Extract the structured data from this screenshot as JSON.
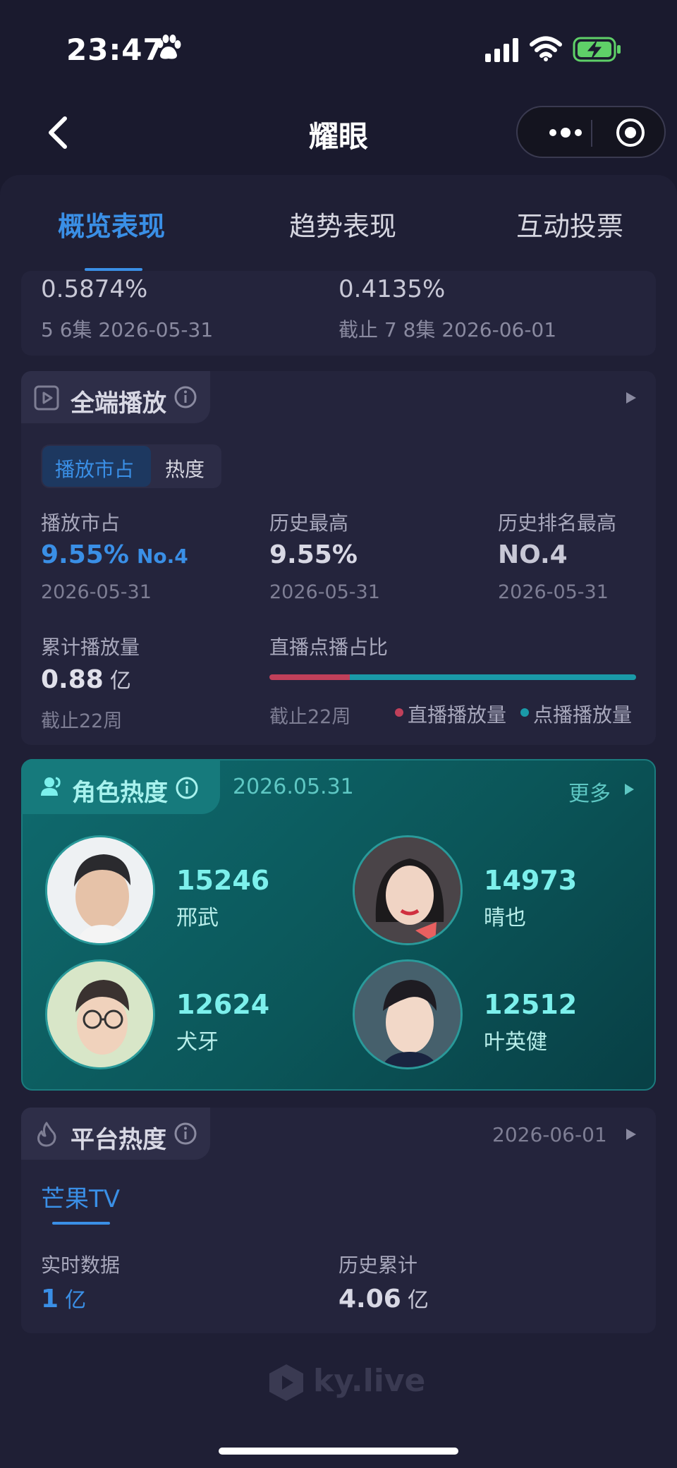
{
  "status_bar": {
    "time": "23:47"
  },
  "nav": {
    "title": "耀眼"
  },
  "tabs": [
    {
      "label": "概览表现",
      "active": true
    },
    {
      "label": "趋势表现",
      "active": false
    },
    {
      "label": "互动投票",
      "active": false
    }
  ],
  "top_stats": [
    {
      "value": "0.5874%",
      "sub": "5 6集 2026-05-31"
    },
    {
      "value": "0.4135%",
      "sub": "截止 7 8集 2026-06-01"
    }
  ],
  "playback": {
    "title": "全端播放",
    "toggle": [
      "播放市占",
      "热度"
    ],
    "market_share": {
      "label": "播放市占",
      "value": "9.55%",
      "rank": "No.4",
      "date": "2026-05-31"
    },
    "history_high": {
      "label": "历史最高",
      "value": "9.55%",
      "date": "2026-05-31"
    },
    "history_rank": {
      "label": "历史排名最高",
      "value": "NO.4",
      "date": "2026-05-31"
    },
    "cumulative": {
      "label": "累计播放量",
      "value": "0.88",
      "unit": "亿",
      "sub": "截止22周"
    },
    "ratio": {
      "label": "直播点播占比",
      "sub": "截止22周",
      "legend": [
        "直播播放量",
        "点播播放量"
      ],
      "live_fraction": 0.22,
      "colors": {
        "live": "#c0405a",
        "vod": "#1a9aa8"
      }
    }
  },
  "role_heat": {
    "title": "角色热度",
    "date": "2026.05.31",
    "more": "更多",
    "roles": [
      {
        "score": "15246",
        "name": "邢武"
      },
      {
        "score": "14973",
        "name": "晴也"
      },
      {
        "score": "12624",
        "name": "犬牙"
      },
      {
        "score": "12512",
        "name": "叶英健"
      }
    ]
  },
  "platform_heat": {
    "title": "平台热度",
    "date": "2026-06-01",
    "platform_tab": "芒果TV",
    "realtime": {
      "label": "实时数据",
      "value": "1",
      "unit": "亿"
    },
    "total": {
      "label": "历史累计",
      "value": "4.06",
      "unit": "亿"
    }
  },
  "watermark": "ky.live",
  "colors": {
    "accent": "#3a8fe6",
    "teal": "#7cf0ec",
    "background": "#1a1a2e"
  }
}
